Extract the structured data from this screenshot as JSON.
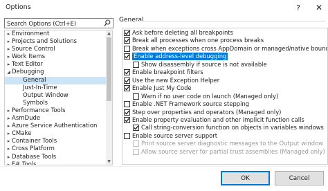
{
  "window": {
    "title": "Options",
    "help_glyph": "?",
    "close_glyph": "✕"
  },
  "search": {
    "placeholder": "Search Options (Ctrl+E)",
    "value": ""
  },
  "tree": {
    "items": [
      {
        "label": "Environment",
        "expanded": false,
        "level": 0
      },
      {
        "label": "Projects and Solutions",
        "expanded": false,
        "level": 0
      },
      {
        "label": "Source Control",
        "expanded": false,
        "level": 0
      },
      {
        "label": "Work Items",
        "expanded": false,
        "level": 0
      },
      {
        "label": "Text Editor",
        "expanded": false,
        "level": 0
      },
      {
        "label": "Debugging",
        "expanded": true,
        "level": 0
      },
      {
        "label": "General",
        "level": 1,
        "selected": true
      },
      {
        "label": "Just-In-Time",
        "level": 1
      },
      {
        "label": "Output Window",
        "level": 1
      },
      {
        "label": "Symbols",
        "level": 1
      },
      {
        "label": "Performance Tools",
        "expanded": false,
        "level": 0
      },
      {
        "label": "AsmDude",
        "expanded": false,
        "level": 0
      },
      {
        "label": "Azure Service Authentication",
        "expanded": false,
        "level": 0
      },
      {
        "label": "CMake",
        "expanded": false,
        "level": 0
      },
      {
        "label": "Container Tools",
        "expanded": false,
        "level": 0
      },
      {
        "label": "Cross Platform",
        "expanded": false,
        "level": 0
      },
      {
        "label": "Database Tools",
        "expanded": false,
        "level": 0
      },
      {
        "label": "F# Tools",
        "expanded": false,
        "level": 0
      }
    ]
  },
  "general": {
    "group_label": "General",
    "options": [
      {
        "label": "Ask before deleting all breakpoints",
        "checked": true,
        "indent": 0
      },
      {
        "label": "Break all processes when one process breaks",
        "checked": true,
        "indent": 0
      },
      {
        "label": "Break when exceptions cross AppDomain or managed/native boundaries (Man",
        "checked": false,
        "indent": 0
      },
      {
        "label": "Enable address-level debugging",
        "checked": true,
        "indent": 0,
        "highlight": true
      },
      {
        "label": "Show disassembly if source is not available",
        "checked": false,
        "indent": 1
      },
      {
        "label": "Enable breakpoint filters",
        "checked": true,
        "indent": 0
      },
      {
        "label": "Use the new Exception Helper",
        "checked": true,
        "indent": 0
      },
      {
        "label": "Enable Just My Code",
        "checked": true,
        "indent": 0
      },
      {
        "label": "Warn if no user code on launch (Managed only)",
        "checked": false,
        "indent": 1
      },
      {
        "label": "Enable .NET Framework source stepping",
        "checked": false,
        "indent": 0
      },
      {
        "label": "Step over properties and operators (Managed only)",
        "checked": true,
        "indent": 0
      },
      {
        "label": "Enable property evaluation and other implicit function calls",
        "checked": true,
        "indent": 0
      },
      {
        "label": "Call string-conversion function on objects in variables windows",
        "checked": true,
        "indent": 1
      },
      {
        "label": "Enable source server support",
        "checked": false,
        "indent": 0
      },
      {
        "label": "Print source server diagnostic messages to the Output window",
        "checked": false,
        "indent": 1,
        "disabled": true
      },
      {
        "label": "Allow source server for partial trust assemblies (Managed only)",
        "checked": false,
        "indent": 1,
        "disabled": true
      }
    ]
  },
  "buttons": {
    "ok": "OK",
    "cancel": "Cancel"
  },
  "colors": {
    "selection": "#cce4f7",
    "highlight": "#0078d7",
    "accent": "#0078d7"
  }
}
